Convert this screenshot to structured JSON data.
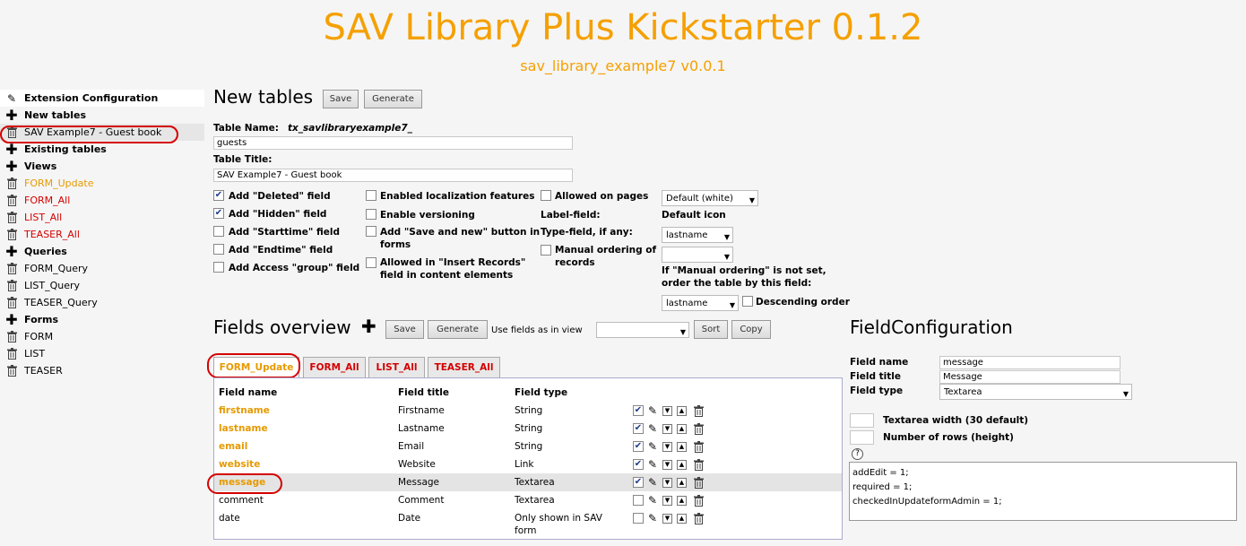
{
  "header": {
    "title": "SAV Library Plus Kickstarter 0.1.2",
    "subtitle": "sav_library_example7 v0.0.1"
  },
  "sidebar": {
    "items": [
      {
        "label": "Extension Configuration",
        "kind": "section",
        "icon": "pen-icon"
      },
      {
        "label": "New tables",
        "kind": "section",
        "icon": "plus-icon"
      },
      {
        "label": "SAV Example7 - Guest book",
        "kind": "item",
        "icon": "trash-icon"
      },
      {
        "label": "Existing tables",
        "kind": "section",
        "icon": "plus-icon"
      },
      {
        "label": "Views",
        "kind": "section",
        "icon": "plus-icon"
      },
      {
        "label": "FORM_Update",
        "kind": "view-orange",
        "icon": "trash-icon"
      },
      {
        "label": "FORM_All",
        "kind": "view-red",
        "icon": "trash-icon"
      },
      {
        "label": "LIST_All",
        "kind": "view-red",
        "icon": "trash-icon"
      },
      {
        "label": "TEASER_All",
        "kind": "view-red",
        "icon": "trash-icon"
      },
      {
        "label": "Queries",
        "kind": "section",
        "icon": "plus-icon"
      },
      {
        "label": "FORM_Query",
        "kind": "item",
        "icon": "trash-icon"
      },
      {
        "label": "LIST_Query",
        "kind": "item",
        "icon": "trash-icon"
      },
      {
        "label": "TEASER_Query",
        "kind": "item",
        "icon": "trash-icon"
      },
      {
        "label": "Forms",
        "kind": "section",
        "icon": "plus-icon"
      },
      {
        "label": "FORM",
        "kind": "item",
        "icon": "trash-icon"
      },
      {
        "label": "LIST",
        "kind": "item",
        "icon": "trash-icon"
      },
      {
        "label": "TEASER",
        "kind": "item",
        "icon": "trash-icon"
      }
    ]
  },
  "new_tables": {
    "heading": "New tables",
    "save": "Save",
    "generate": "Generate",
    "table_name_label": "Table Name:",
    "table_name_prefix": "tx_savlibraryexample7_",
    "table_name_value": "guests",
    "table_title_label": "Table Title:",
    "table_title_value": "SAV Example7 - Guest book",
    "col1": [
      {
        "label": "Add \"Deleted\" field",
        "checked": true
      },
      {
        "label": "Add \"Hidden\" field",
        "checked": true
      },
      {
        "label": "Add \"Starttime\" field",
        "checked": false
      },
      {
        "label": "Add \"Endtime\" field",
        "checked": false
      },
      {
        "label": "Add Access \"group\" field",
        "checked": false
      }
    ],
    "col2": {
      "localization": "Enabled localization features",
      "versioning": "Enable versioning",
      "save_new_1": "Add \"Save and new\" button in",
      "save_new_2": "forms",
      "insert_1": "Allowed in \"Insert Records\"",
      "insert_2": "field in content elements"
    },
    "col3": {
      "allowed_pages": "Allowed on pages",
      "label_field": "Label-field:",
      "type_field": "Type-field, if any:",
      "manual_1": "Manual ordering of",
      "manual_2": "records"
    },
    "col4": {
      "default_white": "Default (white)",
      "default_icon": "Default icon",
      "label_select": "lastname",
      "type_select": "",
      "order_note_1": "If \"Manual ordering\" is not set,",
      "order_note_2": "order the table by this field:",
      "order_select": "lastname",
      "descending": "Descending order"
    }
  },
  "fields_overview": {
    "heading": "Fields overview",
    "save": "Save",
    "generate": "Generate",
    "use_fields_label": "Use fields as in view",
    "view_select": "",
    "sort": "Sort",
    "copy": "Copy",
    "tabs": [
      "FORM_Update",
      "FORM_All",
      "LIST_All",
      "TEASER_All"
    ],
    "columns": [
      "Field name",
      "Field title",
      "Field type"
    ],
    "rows": [
      {
        "name": "firstname",
        "title": "Firstname",
        "type": "String",
        "checked": true,
        "highlight": true
      },
      {
        "name": "lastname",
        "title": "Lastname",
        "type": "String",
        "checked": true,
        "highlight": true
      },
      {
        "name": "email",
        "title": "Email",
        "type": "String",
        "checked": true,
        "highlight": true
      },
      {
        "name": "website",
        "title": "Website",
        "type": "Link",
        "checked": true,
        "highlight": true
      },
      {
        "name": "message",
        "title": "Message",
        "type": "Textarea",
        "checked": true,
        "highlight": true
      },
      {
        "name": "comment",
        "title": "Comment",
        "type": "Textarea",
        "checked": false,
        "highlight": false
      },
      {
        "name": "date",
        "title": "Date",
        "type": "Only shown in SAV",
        "type2": "form",
        "checked": false,
        "highlight": false
      }
    ]
  },
  "field_config": {
    "heading": "FieldConfiguration",
    "name_label": "Field name",
    "name_value": "message",
    "title_label": "Field title",
    "title_value": "Message",
    "type_label": "Field type",
    "type_value": "Textarea",
    "width_label": "Textarea width (30 default)",
    "rows_label": "Number of rows (height)",
    "help": "?",
    "config_lines": [
      "addEdit = 1;",
      "required = 1;",
      "checkedInUpdateformAdmin = 1;"
    ]
  },
  "colors": {
    "accent": "#f5a000",
    "link_red": "#d40000",
    "field_orange": "#e69a00"
  }
}
